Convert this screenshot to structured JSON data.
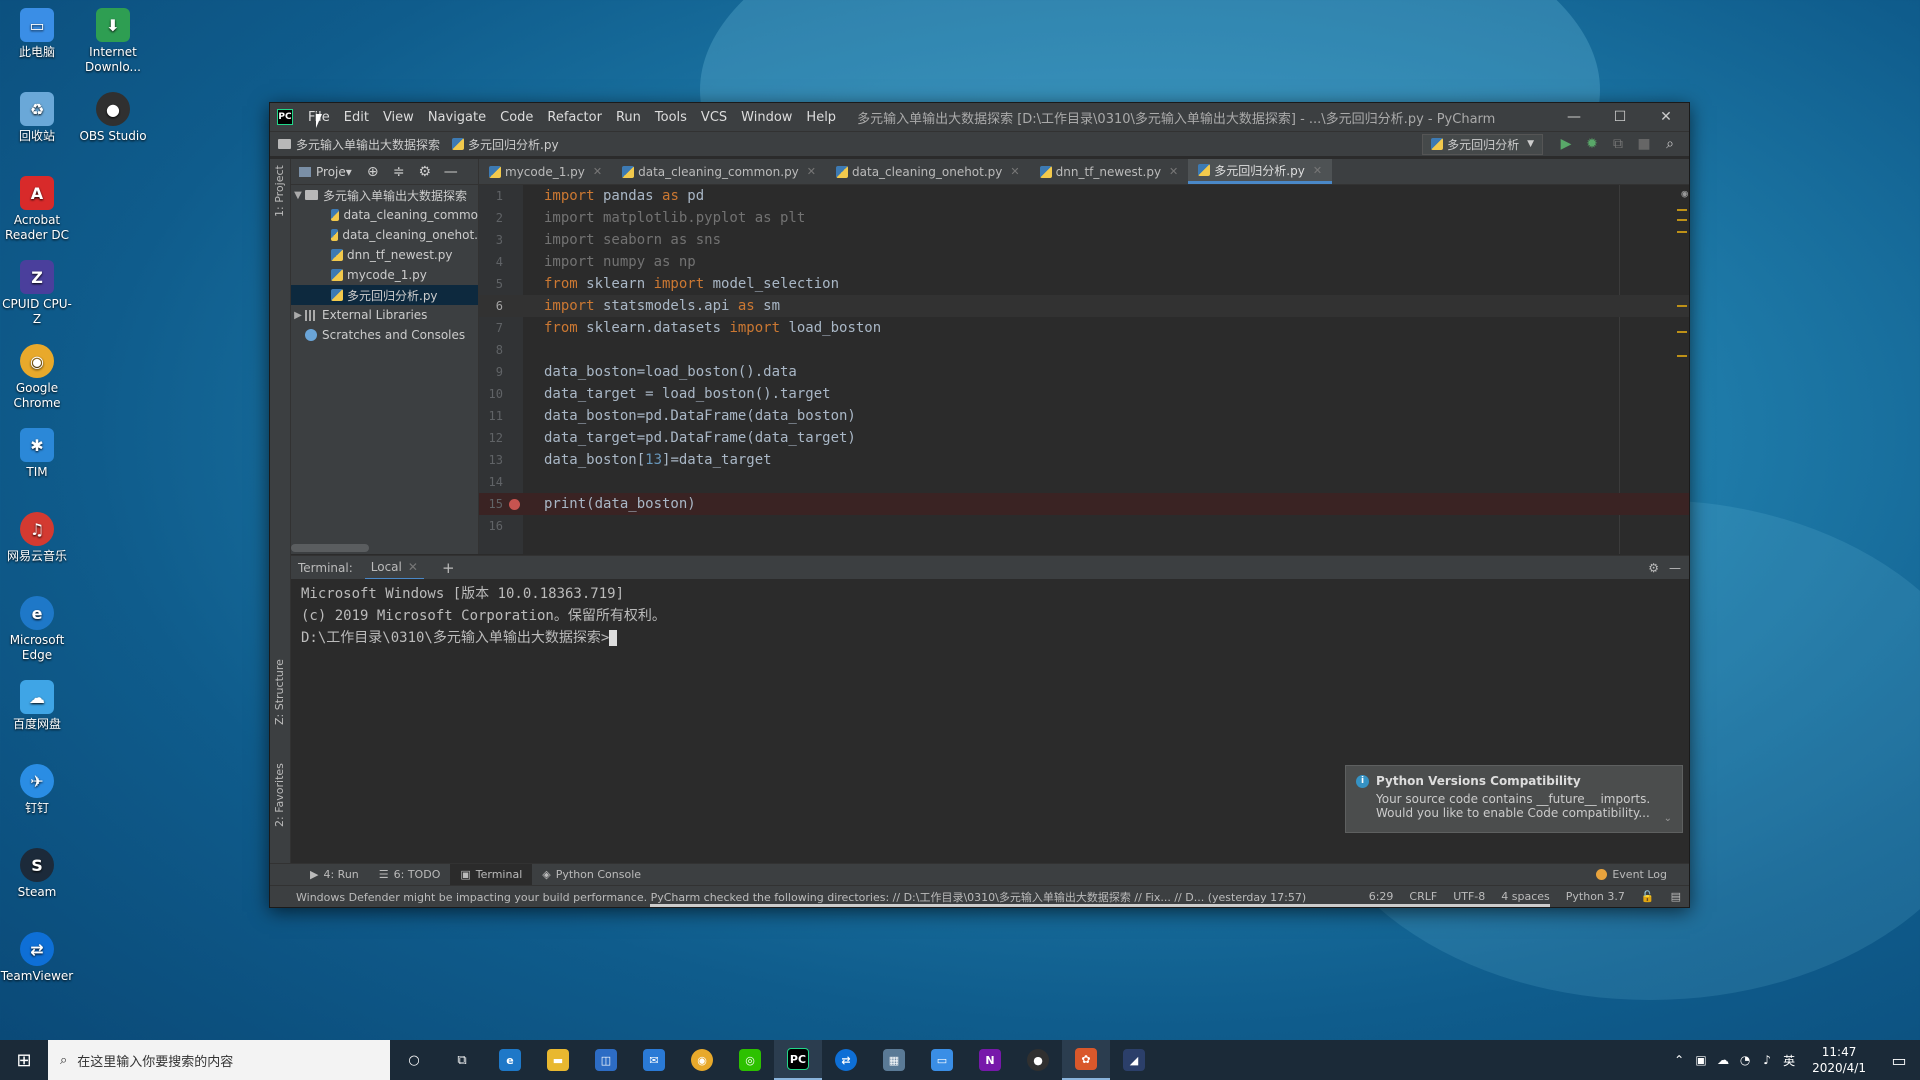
{
  "desktop": {
    "icons": [
      {
        "label": "此电脑",
        "glyph": "▭",
        "color": "#3a8ee6"
      },
      {
        "label": "Internet Downlo...",
        "glyph": "⬇",
        "color": "#2e9e52"
      },
      {
        "label": "回收站",
        "glyph": "🗑",
        "color": "#6aa8d8"
      },
      {
        "label": "OBS Studio",
        "glyph": "●",
        "color": "#303030"
      },
      {
        "label": "Acrobat Reader DC",
        "glyph": "A",
        "color": "#d82a2a"
      },
      {
        "label": "CPUID CPU-Z",
        "glyph": "Z",
        "color": "#4a3f9c"
      },
      {
        "label": "Google Chrome",
        "glyph": "◉",
        "color": "#e8a92b"
      },
      {
        "label": "TIM",
        "glyph": "✱",
        "color": "#2b88d8"
      },
      {
        "label": "网易云音乐",
        "glyph": "♫",
        "color": "#d33a31"
      },
      {
        "label": "Microsoft Edge",
        "glyph": "e",
        "color": "#1e78c8"
      },
      {
        "label": "百度网盘",
        "glyph": "☁",
        "color": "#3fa5e6"
      },
      {
        "label": "钉钉",
        "glyph": "✈",
        "color": "#2a8de4"
      },
      {
        "label": "Steam",
        "glyph": "S",
        "color": "#1c2a3a"
      },
      {
        "label": "TeamViewer",
        "glyph": "⇄",
        "color": "#0e6fd6"
      }
    ]
  },
  "window": {
    "logo": "PC",
    "menu": [
      "File",
      "Edit",
      "View",
      "Navigate",
      "Code",
      "Refactor",
      "Run",
      "Tools",
      "VCS",
      "Window",
      "Help"
    ],
    "title": "多元输入单输出大数据探索 [D:\\工作目录\\0310\\多元输入单输出大数据探索] - ...\\多元回归分析.py - PyCharm",
    "controls": {
      "minimize": "—",
      "maximize": "☐",
      "close": "✕"
    }
  },
  "navbar": {
    "breadcrumb_project": "多元输入单输出大数据探索",
    "breadcrumb_file": "多元回归分析.py",
    "run_config": "多元回归分析",
    "run_glyph": "▶",
    "debug_glyph": "✹",
    "coverage_glyph": "⧉",
    "stop_glyph": "■",
    "search_glyph": "⌕"
  },
  "side_tabs": {
    "project": "1: Project",
    "structure": "Z: Structure",
    "favorites": "2: Favorites"
  },
  "project_panel": {
    "header": "Proje▾",
    "root": "多元输入单输出大数据探索",
    "files": [
      "data_cleaning_commo",
      "data_cleaning_onehot.",
      "dnn_tf_newest.py",
      "mycode_1.py",
      "多元回归分析.py"
    ],
    "external": "External Libraries",
    "scratches": "Scratches and Consoles"
  },
  "editor": {
    "tabs": [
      "mycode_1.py",
      "data_cleaning_common.py",
      "data_cleaning_onehot.py",
      "dnn_tf_newest.py",
      "多元回归分析.py"
    ],
    "active_tab": 4
  },
  "terminal": {
    "label": "Terminal:",
    "tab": "Local",
    "add": "+",
    "lines": [
      "Microsoft Windows [版本 10.0.18363.719]",
      "(c) 2019 Microsoft Corporation。保留所有权利。",
      "D:\\工作目录\\0310\\多元输入单输出大数据探索>"
    ]
  },
  "notification": {
    "title": "Python Versions Compatibility",
    "line1": "Your source code contains __future__ imports.",
    "line2": "Would you like to enable Code compatibility..."
  },
  "tool_tabs": {
    "run": "4: Run",
    "todo": "6: TODO",
    "terminal": "Terminal",
    "console": "Python Console",
    "event_log": "Event Log"
  },
  "status": {
    "message": "Windows Defender might be impacting your build performance. PyCharm checked the following directories: // D:\\工作目录\\0310\\多元输入单输出大数据探索 // Fix... // D... (yesterday 17:57)",
    "position": "6:29",
    "line_sep": "CRLF",
    "encoding": "UTF-8",
    "indent": "4 spaces",
    "interpreter": "Python 3.7"
  },
  "taskbar": {
    "search_placeholder": "在这里输入你要搜索的内容",
    "clock_time": "11:47",
    "clock_date": "2020/4/1",
    "ime": "英"
  }
}
